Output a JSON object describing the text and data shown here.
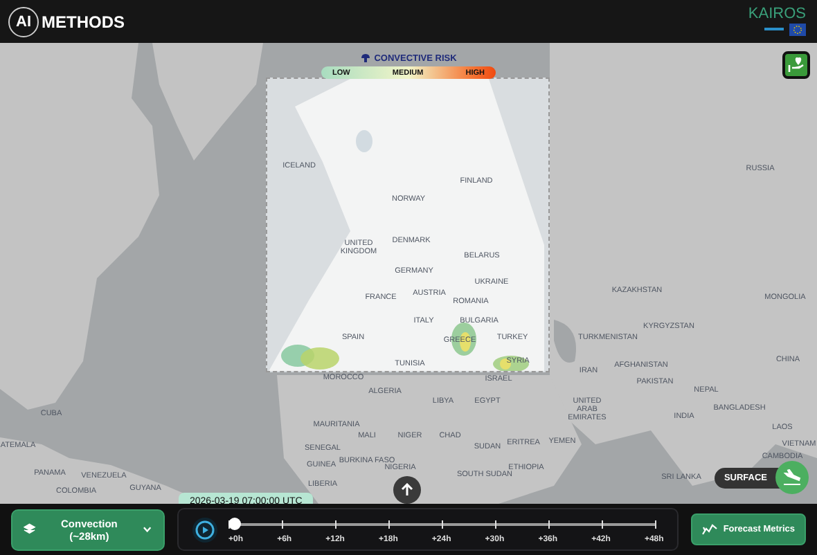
{
  "header": {
    "logo_badge": "AI",
    "logo_text": "METHODS",
    "partner": "KAIROS"
  },
  "legend": {
    "title": "CONVECTIVE RISK",
    "labels": [
      "LOW",
      "MEDIUM",
      "HIGH"
    ]
  },
  "map_labels": [
    "ICELAND",
    "NORWAY",
    "FINLAND",
    "UNITED KINGDOM",
    "DENMARK",
    "BELARUS",
    "GERMANY",
    "UKRAINE",
    "FRANCE",
    "AUSTRIA",
    "ROMANIA",
    "ITALY",
    "BULGARIA",
    "SPAIN",
    "GREECE",
    "TURKEY",
    "TUNISIA",
    "SYRIA",
    "MOROCCO",
    "ISRAEL",
    "RUSSIA",
    "KAZAKHSTAN",
    "MONGOLIA",
    "KYRGYZSTAN",
    "TURKMENISTAN",
    "CHINA",
    "IRAN",
    "AFGHANISTAN",
    "PAKISTAN",
    "NEPAL",
    "UNITED ARAB EMIRATES",
    "BANGLADESH",
    "INDIA",
    "LAOS",
    "YEMEN",
    "VIETNAM",
    "CAMBODIA",
    "SRI LANKA",
    "CUBA",
    "ATEMALA",
    "PANAMA",
    "VENEZUELA",
    "COLOMBIA",
    "GUYANA",
    "ALGERIA",
    "LIBYA",
    "EGYPT",
    "MAURITANIA",
    "MALI",
    "NIGER",
    "CHAD",
    "SUDAN",
    "ERITREA",
    "SENEGAL",
    "BURKINA FASO",
    "GUINEA",
    "NIGERIA",
    "SOUTH SUDAN",
    "ETHIOPIA",
    "LIBERIA"
  ],
  "surface_toggle": {
    "label": "SURFACE"
  },
  "layer_select": {
    "value": "Convection (~28km)"
  },
  "timeline": {
    "timestamp": "2026-03-19 07:00:00 UTC",
    "level": 0,
    "ticks": [
      "+0h",
      "+6h",
      "+12h",
      "+18h",
      "+24h",
      "+30h",
      "+36h",
      "+42h",
      "+48h"
    ]
  },
  "forecast_button": {
    "label": "Forecast Metrics"
  }
}
